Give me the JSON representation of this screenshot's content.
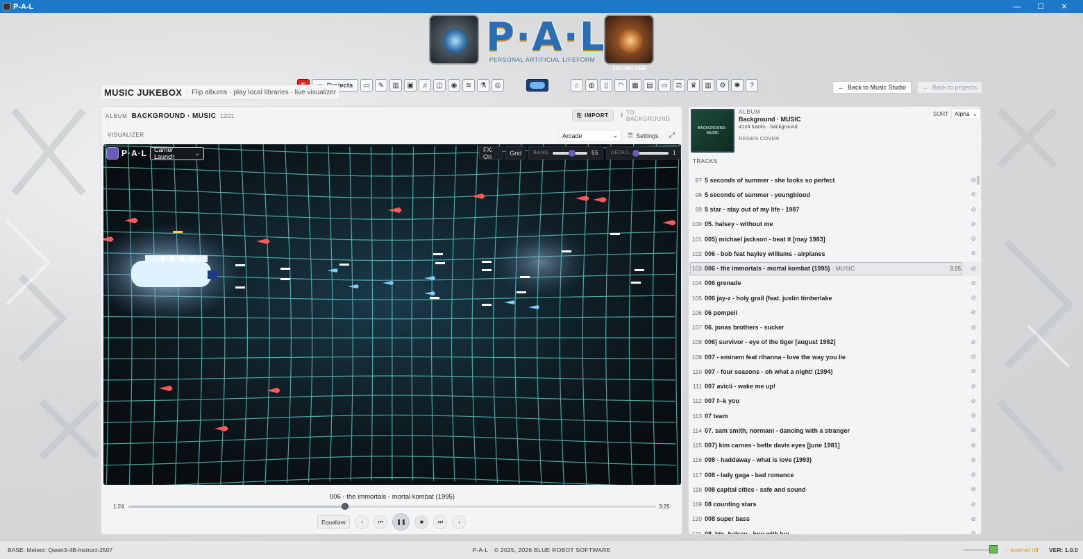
{
  "window": {
    "title": "P-A-L",
    "controls": [
      "—",
      "☐",
      "✕"
    ]
  },
  "logo": {
    "text": "P·A·L",
    "subtitle": "PERSONAL ARTIFICIAL LIFEFORM",
    "right_badge": "SECOND TIER"
  },
  "toolbar": {
    "e_label": "E",
    "projects_label": "Projects",
    "icons_left": [
      "chat-icon",
      "pencil-icon",
      "book-icon",
      "image-icon",
      "music-icon",
      "gamepad-icon",
      "bot-icon",
      "waveform-icon",
      "flask-icon",
      "globe-icon"
    ],
    "icons_left_glyphs": [
      "▭",
      "✎",
      "▥",
      "▣",
      "♫",
      "◫",
      "◉",
      "≋",
      "⚗",
      "◎"
    ],
    "icons_right": [
      "home-icon",
      "compass-icon",
      "server-icon",
      "speed-icon",
      "cpu-icon",
      "archive-icon",
      "drive-icon",
      "scale-icon",
      "trophy-icon",
      "book-open-icon",
      "gear-icon",
      "bug-icon",
      "help-icon"
    ],
    "icons_right_glyphs": [
      "⌂",
      "◍",
      "▯",
      "◠",
      "▦",
      "▤",
      "▭",
      "⚖",
      "♛",
      "▥",
      "⚙",
      "✱",
      "?"
    ]
  },
  "page": {
    "title": "MUSIC JUKEBOX",
    "subtitle": "Flip albums · play local libraries · live visualizer"
  },
  "nav": {
    "back_music_studio": "Back to Music Studio",
    "back_projects": "Back to projects"
  },
  "album": {
    "label": "ALBUM",
    "name": "BACKGROUND · MUSIC",
    "counter": "12/21"
  },
  "actions": {
    "import": "IMPORT",
    "to_background": "TO BACKGROUND"
  },
  "visualizer": {
    "label": "VISUALIZER",
    "mode": "Arcade",
    "settings": "Settings",
    "brand": "P·A·L",
    "preset": "Carrier Launch",
    "fx": "FX: On",
    "grid": "Grid",
    "bang_label": "BANG",
    "bang_value": 55,
    "bang_fraction": 0.55,
    "detail_label": "DETAIL",
    "detail_value": 1,
    "detail_fraction": 0.0
  },
  "player": {
    "now_playing": "006 - the immortals - mortal kombat (1995)",
    "elapsed": "1:24",
    "duration": "3:25",
    "progress": 0.41,
    "equalizer": "Equalizer"
  },
  "album_info": {
    "label": "ALBUM",
    "name": "Background · MUSIC",
    "meta": "4124 tracks · background",
    "regen": "REGEN COVER",
    "cover_text": "BACKGROUND · MUSIC",
    "sort_label": "SORT",
    "sort_value": "Alpha",
    "tracks_label": "TRACKS"
  },
  "tracks": [
    {
      "n": "97",
      "title": "5 seconds of summer - she looks so perfect"
    },
    {
      "n": "98",
      "title": "5 seconds of summer - youngblood"
    },
    {
      "n": "99",
      "title": "5 star - stay out of my life - 1987"
    },
    {
      "n": "100",
      "title": "05. halsey - without me"
    },
    {
      "n": "101",
      "title": "005) michael jackson - beat it [may 1983]"
    },
    {
      "n": "102",
      "title": "006 - bob feat hayley williams - airplanes"
    },
    {
      "n": "103",
      "title": "006 - the immortals - mortal kombat (1995)",
      "suffix": "· MUSIC",
      "dur": "3:25",
      "active": true
    },
    {
      "n": "104",
      "title": "006 grenade"
    },
    {
      "n": "105",
      "title": "006 jay-z - holy grail (feat. justin timberlake"
    },
    {
      "n": "106",
      "title": "06 pompeii"
    },
    {
      "n": "107",
      "title": "06. jonas brothers - sucker"
    },
    {
      "n": "108",
      "title": "006) survivor - eye of the tiger [august 1982]"
    },
    {
      "n": "109",
      "title": "007 - eminem feat rihanna - love the way you lie"
    },
    {
      "n": "110",
      "title": "007 - four seasons - oh what a night! (1994)"
    },
    {
      "n": "111",
      "title": "007 avicii - wake me up!"
    },
    {
      "n": "112",
      "title": "007 f--k you"
    },
    {
      "n": "113",
      "title": "07 team"
    },
    {
      "n": "114",
      "title": "07. sam smith, normani - dancing with a stranger"
    },
    {
      "n": "115",
      "title": "007) kim carnes - bette davis eyes [june 1981]"
    },
    {
      "n": "116",
      "title": "008 - haddaway - what is love (1993)"
    },
    {
      "n": "117",
      "title": "008 - lady gaga - bad romance"
    },
    {
      "n": "118",
      "title": "008 capital cities - safe and sound"
    },
    {
      "n": "119",
      "title": "08 counting stars"
    },
    {
      "n": "120",
      "title": "008 super bass"
    },
    {
      "n": "121",
      "title": "08. bts, halsey - boy with luv"
    }
  ],
  "footer": {
    "base": "BASE: Meteor: Qwen3-4B-Instruct-2507",
    "copyright": "P-A-L · © 2025, 2026 BLUE ROBOT SOFTWARE",
    "internet": "Internet off",
    "version": "VER: 1.0.0"
  }
}
